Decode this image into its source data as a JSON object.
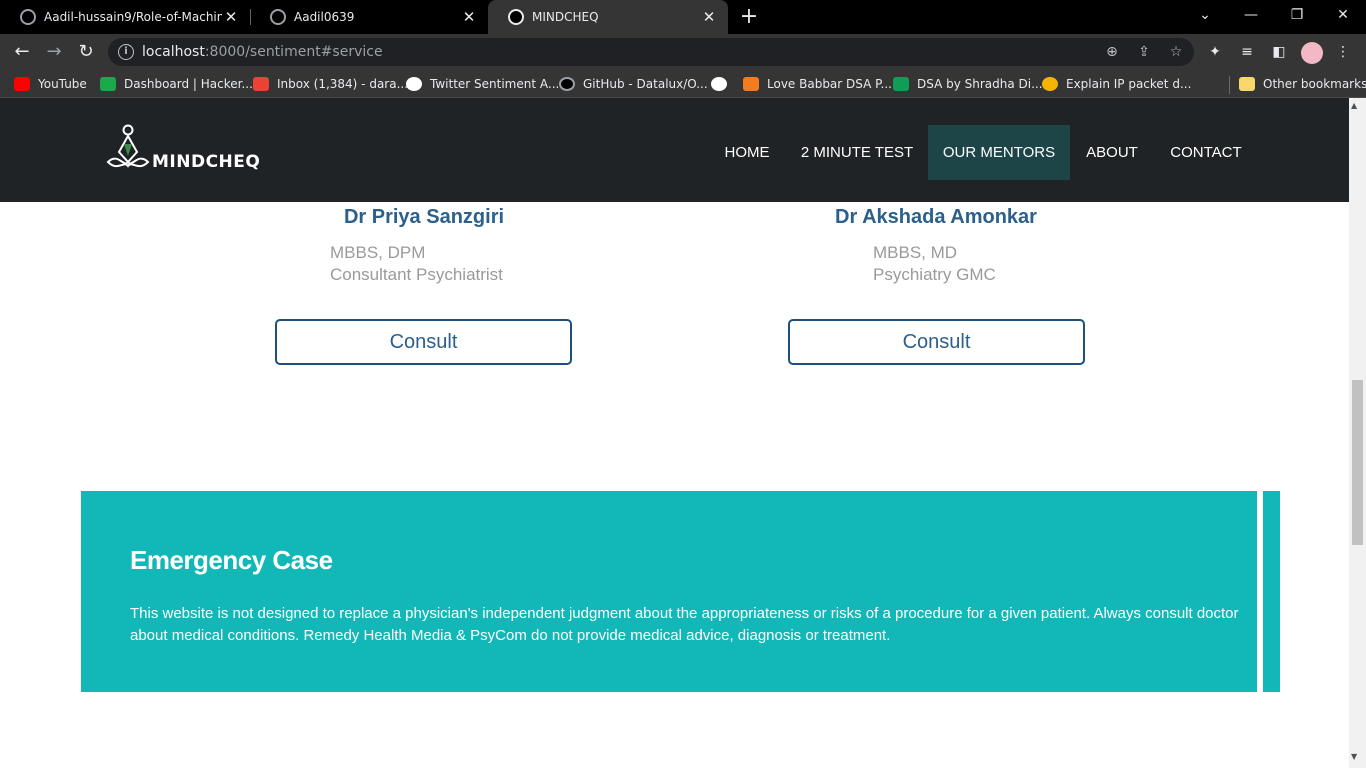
{
  "browser": {
    "tabs": [
      {
        "title": "Aadil-hussain9/Role-of-Machine-",
        "icon": "github-icon"
      },
      {
        "title": "Aadil0639",
        "icon": "github-icon"
      },
      {
        "title": "MINDCHEQ",
        "icon": "globe-icon"
      }
    ],
    "new_tab_label": "+",
    "url_host": "localhost",
    "url_rest": ":8000/sentiment#service",
    "bookmarks": [
      {
        "label": "YouTube",
        "color": "#ff0000"
      },
      {
        "label": "Dashboard | Hacker...",
        "color": "#1ba94c"
      },
      {
        "label": "Inbox (1,384) - dara...",
        "color": "#ea4335"
      },
      {
        "label": "Twitter Sentiment A...",
        "color": "#ffffff"
      },
      {
        "label": "GitHub - Datalux/O...",
        "color": "#000000"
      },
      {
        "label": "",
        "color": "#ffffff"
      },
      {
        "label": "Love Babbar DSA P...",
        "color": "#f47c20"
      },
      {
        "label": "DSA by Shradha Di...",
        "color": "#0f9d58"
      },
      {
        "label": "Explain IP packet d...",
        "color": "#f4b400"
      }
    ],
    "other_bookmarks": "Other bookmarks"
  },
  "site": {
    "logo_text": "MINDCHEQ",
    "nav": [
      {
        "label": "HOME",
        "active": false
      },
      {
        "label": "2 MINUTE TEST",
        "active": false
      },
      {
        "label": "OUR MENTORS",
        "active": true
      },
      {
        "label": "ABOUT",
        "active": false
      },
      {
        "label": "CONTACT",
        "active": false
      }
    ]
  },
  "mentors": [
    {
      "name": "Dr Priya Sanzgiri",
      "degree": "MBBS, DPM",
      "role": "Consultant Psychiatrist",
      "button": "Consult"
    },
    {
      "name": "Dr Akshada Amonkar",
      "degree": "MBBS, MD",
      "role": "Psychiatry GMC",
      "button": "Consult"
    }
  ],
  "emergency": {
    "title": "Emergency Case",
    "text": "This website is not designed to replace a physician's independent judgment about the appropriateness or risks of a procedure for a given patient. Always consult doctor about medical conditions. Remedy Health Media & PsyCom do not provide medical advice, diagnosis or treatment."
  },
  "colors": {
    "navbar": "#1f2326",
    "nav_active": "#1d4447",
    "accent_teal": "#12b8b8",
    "name_blue": "#2b5f8c"
  }
}
